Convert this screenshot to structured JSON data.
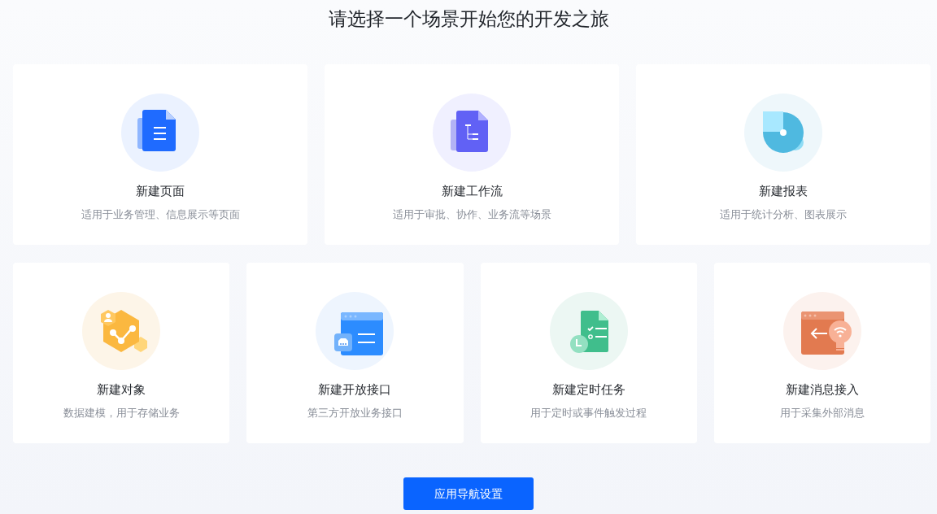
{
  "heading": "请选择一个场景开始您的开发之旅",
  "top_cards": [
    {
      "kind": "page",
      "title": "新建页面",
      "description": "适用于业务管理、信息展示等页面"
    },
    {
      "kind": "workflow",
      "title": "新建工作流",
      "description": "适用于审批、协作、业务流等场景"
    },
    {
      "kind": "report",
      "title": "新建报表",
      "description": "适用于统计分析、图表展示"
    }
  ],
  "bottom_cards": [
    {
      "kind": "object",
      "title": "新建对象",
      "description": "数据建模，用于存储业务"
    },
    {
      "kind": "api",
      "title": "新建开放接口",
      "description": "第三方开放业务接口"
    },
    {
      "kind": "timer",
      "title": "新建定时任务",
      "description": "用于定时或事件触发过程"
    },
    {
      "kind": "message",
      "title": "新建消息接入",
      "description": "用于采集外部消息"
    }
  ],
  "button": "应用导航设置"
}
